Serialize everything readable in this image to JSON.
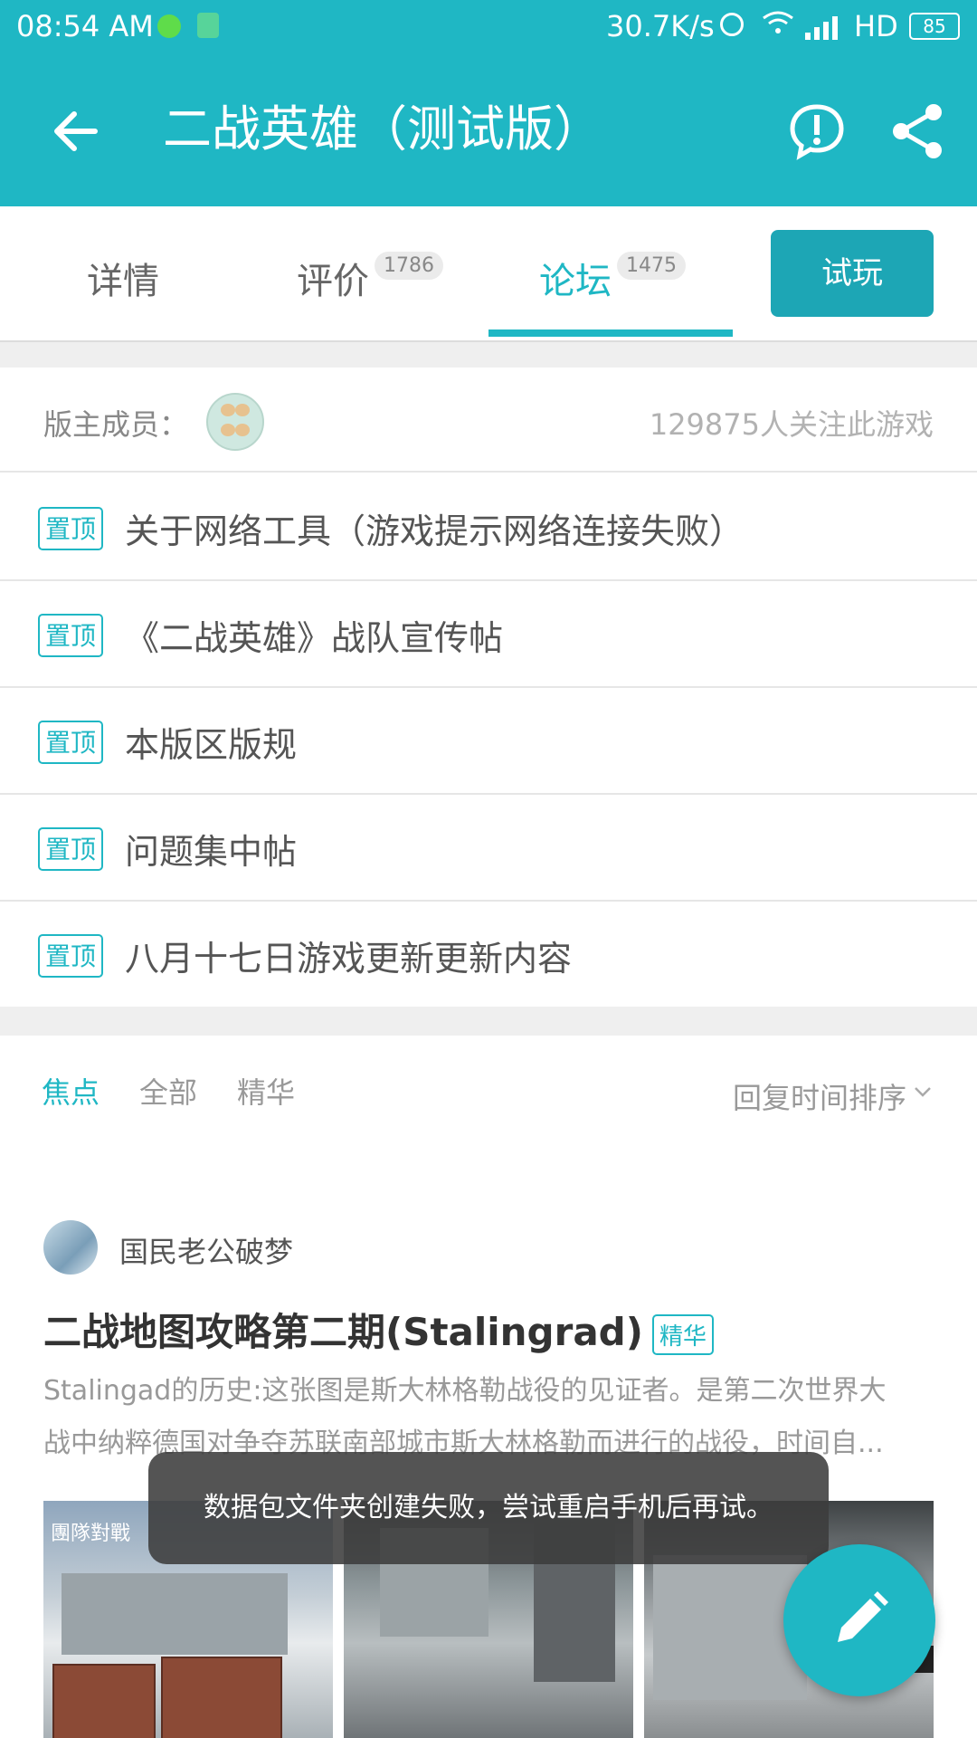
{
  "status_bar": {
    "time": "08:54 AM",
    "net_speed": "30.7K/s",
    "network": "HD",
    "battery": "85"
  },
  "app_bar": {
    "title": "二战英雄（测试版）",
    "back_icon": "arrow-left-icon",
    "report_icon": "exclamation-circle-icon",
    "share_icon": "share-icon"
  },
  "tabs": {
    "items": [
      {
        "label": "详情",
        "badge": ""
      },
      {
        "label": "评价",
        "badge": "1786"
      },
      {
        "label": "论坛",
        "badge": "1475"
      }
    ],
    "active": "论坛",
    "try_button": "试玩"
  },
  "moderators": {
    "label": "版主成员：",
    "followers": "129875人关注此游戏"
  },
  "pinned_posts": [
    {
      "badge": "置顶",
      "title": "关于网络工具（游戏提示网络连接失败）"
    },
    {
      "badge": "置顶",
      "title": "《二战英雄》战队宣传帖"
    },
    {
      "badge": "置顶",
      "title": "本版区版规"
    },
    {
      "badge": "置顶",
      "title": "问题集中帖"
    },
    {
      "badge": "置顶",
      "title": "八月十七日游戏更新更新内容"
    }
  ],
  "filters": {
    "items": [
      "焦点",
      "全部",
      "精华"
    ],
    "active": "焦点",
    "sort_label": "回复时间排序"
  },
  "post": {
    "author": "国民老公破梦",
    "title": "二战地图攻略第二期(Stalingrad)",
    "tag": "精华",
    "excerpt_line1": "Stalingad的历史:这张图是斯大林格勒战役的见证者。是第二次世界大",
    "excerpt_line2": "战中纳粹德国对争夺苏联南部城市斯大林格勒而进行的战役，时间自...",
    "image1_caption": "團隊對戰"
  },
  "toast": {
    "message": "数据包文件夹创建失败，尝试重启手机后再试。"
  },
  "fab": {
    "icon": "pencil-icon"
  },
  "colors": {
    "accent": "#1fb7c4",
    "try_button": "#1da6b5"
  }
}
